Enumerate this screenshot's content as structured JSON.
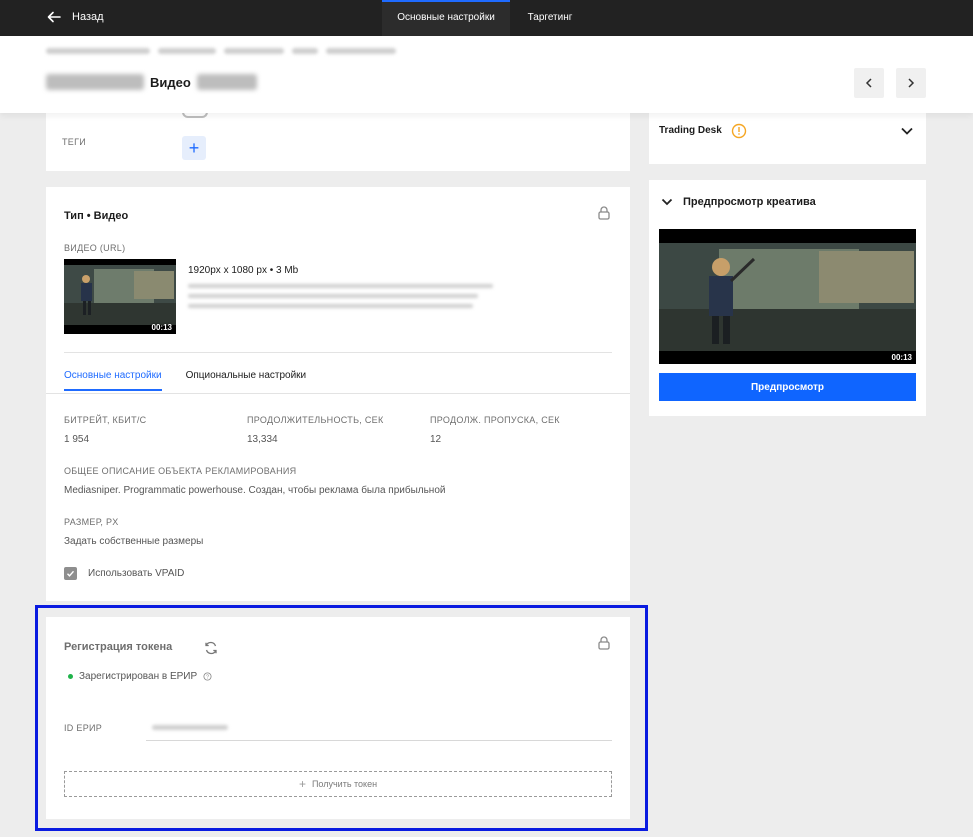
{
  "topbar": {
    "back_label": "Назад",
    "tabs": [
      {
        "label": "Основные настройки",
        "active": true
      },
      {
        "label": "Таргетинг",
        "active": false
      }
    ],
    "accent": "#1f6bff"
  },
  "header": {
    "title": "Видео"
  },
  "tags": {
    "label": "ТЕГИ"
  },
  "type_card": {
    "title": "Тип • Видео",
    "video_url_label": "ВИДЕО (URL)",
    "video_meta": "1920px x 1080 px • 3 Mb",
    "thumb_duration": "00:13",
    "tabs": [
      {
        "label": "Основные настройки",
        "active": true
      },
      {
        "label": "Опциональные настройки",
        "active": false
      }
    ],
    "fields": [
      {
        "label": "БИТРЕЙТ, КБИТ/С",
        "value": "1 954"
      },
      {
        "label": "ПРОДОЛЖИТЕЛЬНОСТЬ, СЕК",
        "value": "13,334"
      },
      {
        "label": "ПРОДОЛЖ. ПРОПУСКА, СЕК",
        "value": "12"
      }
    ],
    "description_label": "ОБЩЕЕ ОПИСАНИЕ ОБЪЕКТА РЕКЛАМИРОВАНИЯ",
    "description_value": "Mediasniper. Programmatic powerhouse. Создан, чтобы реклама была прибыльной",
    "size_label": "РАЗМЕР, PX",
    "size_value": "Задать собственные размеры",
    "vpaid_label": "Использовать VPAID",
    "vpaid_checked": true
  },
  "token_card": {
    "title": "Регистрация токена",
    "status": "Зарегистрирован в ЕРИР",
    "status_color": "#1fb34a",
    "erir_label": "ID ЕРИР",
    "get_token_label": "Получить токен"
  },
  "trading_desk": {
    "label": "Trading Desk",
    "warning_color": "#f5a623"
  },
  "preview": {
    "title": "Предпросмотр креатива",
    "duration": "00:13",
    "button_label": "Предпросмотр",
    "button_color": "#0f65ff"
  }
}
